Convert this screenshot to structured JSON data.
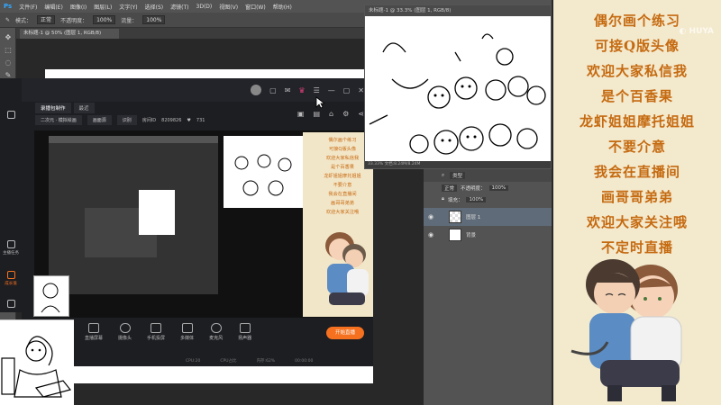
{
  "photoshop": {
    "app_logo": "Ps",
    "menu": [
      "文件(F)",
      "编辑(E)",
      "图像(I)",
      "图层(L)",
      "文字(Y)",
      "选择(S)",
      "滤镜(T)",
      "3D(D)",
      "视图(V)",
      "窗口(W)",
      "帮助(H)"
    ],
    "options_bar": {
      "mode_label": "模式：",
      "mode_value": "正常",
      "opacity_label": "不透明度：",
      "opacity_value": "100%",
      "flow_label": "流量：",
      "flow_value": "100%"
    },
    "doc_tab": "未标题-1 @ 50% (图层 1, RGB/8)",
    "doc2_title": "未标题-1 @ 33.3% (图层 1, RGB/8)",
    "doc2_status": "33.33%   文档:8.24M/8.24M",
    "layers_panel": {
      "kind_label": "类型",
      "blend_value": "正常",
      "opacity_label": "不透明度：",
      "opacity_value": "100%",
      "fill_label": "填充：",
      "fill_value": "100%",
      "layers": [
        {
          "name": "图层 1",
          "selected": true
        },
        {
          "name": "背景",
          "selected": false
        }
      ]
    }
  },
  "recorder": {
    "tabs": [
      "录播包制作",
      "最近"
    ],
    "source_value": "二次元 · 模拟绘画",
    "mode_value": "画面源",
    "share_label": "识别",
    "room_info": "房间ID",
    "room_id": "8209826",
    "fans": "731",
    "bottom_buttons": [
      "直播屏幕",
      "摄像头",
      "手机投屏",
      "多媒体",
      "麦克风",
      "扬声器"
    ],
    "start_label": "开始直播",
    "status_items": [
      "CPU:20",
      "CPU占比",
      "内存:62%",
      "00:00:00"
    ],
    "sidebar": [
      "主播任务",
      "成长值",
      "消息"
    ]
  },
  "note_lines": [
    "偶尔画个练习",
    "可接Q版头像",
    "欢迎大家私信我",
    "是个百香果",
    "龙虾姐姐摩托姐姐",
    "不要介意",
    "我会在直播间",
    "画哥哥弟弟",
    "欢迎大家关注哦",
    "不定时直播"
  ],
  "mini_note_lines": [
    "偶尔画个练习",
    "可接Q版头像",
    "欢迎大家私信我",
    "是个百香果",
    "龙虾姐姐摩托姐姐",
    "不要介意",
    "我会在直播间",
    "画哥哥弟弟",
    "欢迎大家关注哦"
  ],
  "colors": {
    "note_text": "#c56a10",
    "note_bg": "#f3e9cd",
    "start_button": "#f5711f"
  }
}
